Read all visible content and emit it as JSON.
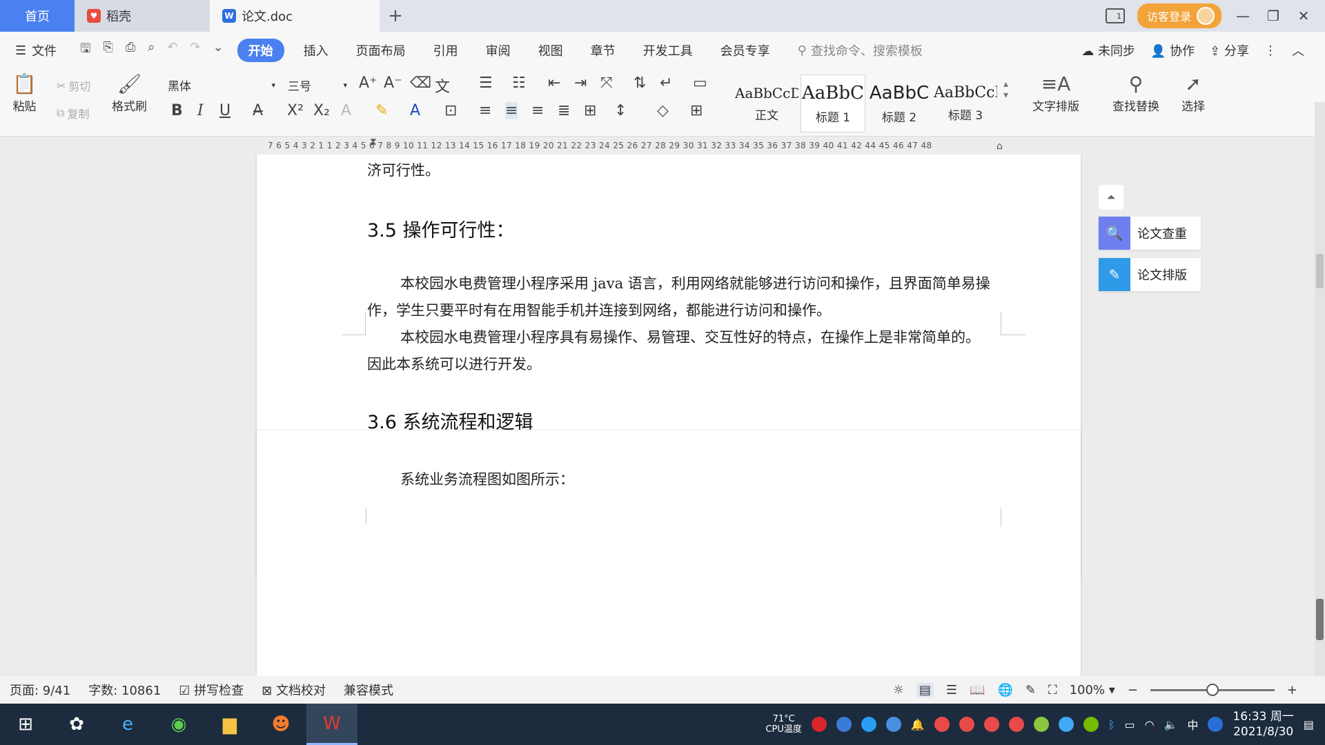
{
  "titlebar": {
    "tab_home": "首页",
    "tab_daoke": "稻壳",
    "tab_doc": "论文.doc",
    "add_tab": "+",
    "login": "访客登录",
    "screen_badge": "1",
    "minimize": "—",
    "restore": "❐",
    "close": "✕"
  },
  "menubar": {
    "file": "文件",
    "tabs": [
      "开始",
      "插入",
      "页面布局",
      "引用",
      "审阅",
      "视图",
      "章节",
      "开发工具",
      "会员专享"
    ],
    "search_placeholder": "查找命令、搜索模板",
    "unsynced": "未同步",
    "collaborate": "协作",
    "share": "分享"
  },
  "ribbon": {
    "paste": "粘贴",
    "cut": "剪切",
    "copy": "复制",
    "format_painter": "格式刷",
    "font_name": "黑体",
    "font_size": "三号",
    "styles": [
      {
        "sample": "AaBbCcDd",
        "name": "正文"
      },
      {
        "sample": "AaBbC",
        "name": "标题 1"
      },
      {
        "sample": "AaBbC",
        "name": "标题 2"
      },
      {
        "sample": "AaBbCcI",
        "name": "标题 3"
      }
    ],
    "text_layout": "文字排版",
    "find_replace": "查找替换",
    "select": "选择"
  },
  "ruler": {
    "ticks": "7   6   5   4   3   2   1       1   2   3   4   5   6   7   8   9  10  11  12  13  14  15  16  17  18  19  20  21  22  23  24  25  26  27  28  29  30  31  32  33  34  35  36  37  38  39  40  41  42      44  45  46  47  48"
  },
  "document": {
    "prev_tail": "济可行性。",
    "heading_35": "3.5 操作可行性：",
    "para_35_1": "本校园水电费管理小程序采用 java 语言，利用网络就能够进行访问和操作，且界面简单易操作，学生只要平时有在用智能手机并连接到网络，都能进行访问和操作。",
    "para_35_2": "本校园水电费管理小程序具有易操作、易管理、交互性好的特点，在操作上是非常简单的。因此本系统可以进行开发。",
    "heading_36": "3.6 系统流程和逻辑",
    "para_36_1": "系统业务流程图如图所示："
  },
  "sidepanel": {
    "check": "论文查重",
    "layout": "论文排版"
  },
  "statusbar": {
    "page": "页面: 9/41",
    "words": "字数: 10861",
    "spellcheck": "拼写检查",
    "proofread": "文档校对",
    "compat": "兼容模式",
    "zoom": "100%",
    "zoom_level": 0.5
  },
  "taskbar": {
    "cpu_temp": "71°C",
    "cpu_label": "CPU温度",
    "ime": "中",
    "time": "16:33 周一",
    "date": "2021/8/30"
  },
  "colors": {
    "accent": "#4a80f0",
    "login": "#f2a33a",
    "side_check": "#6f7ff0",
    "side_layout": "#2f9ae8",
    "taskbar": "#1c2b3d"
  }
}
